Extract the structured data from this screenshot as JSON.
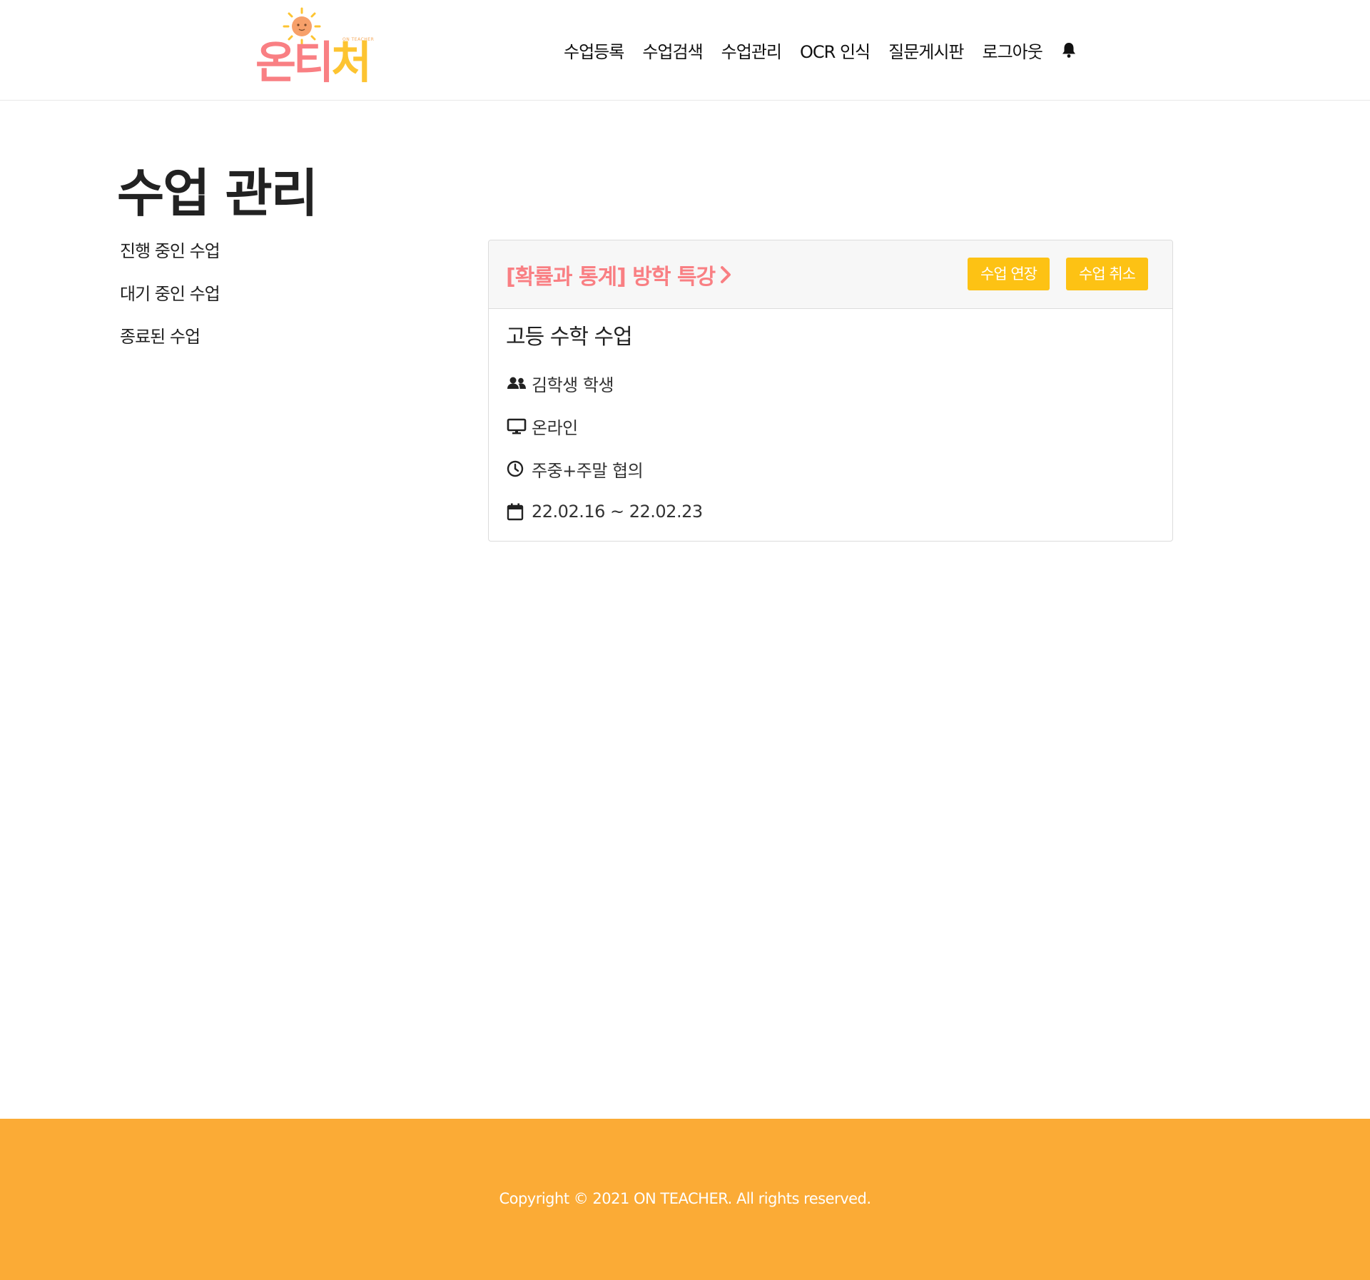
{
  "brand": {
    "logo_text_1": "온",
    "logo_text_2": "티",
    "logo_text_3": "처",
    "logo_sub": "ON TEACHER",
    "colors": {
      "pink": "#f97f83",
      "yellow": "#fdc431",
      "orange": "#fbab36",
      "button": "#fdc214"
    }
  },
  "nav": {
    "items": [
      {
        "label": "수업등록"
      },
      {
        "label": "수업검색"
      },
      {
        "label": "수업관리"
      },
      {
        "label": "OCR 인식"
      },
      {
        "label": "질문게시판"
      },
      {
        "label": "로그아웃"
      }
    ],
    "bell_icon": "bell-icon"
  },
  "page": {
    "title": "수업 관리"
  },
  "side_menu": {
    "items": [
      {
        "label": "진행 중인 수업"
      },
      {
        "label": "대기 중인 수업"
      },
      {
        "label": "종료된 수업"
      }
    ]
  },
  "card": {
    "title": "[확률과 통계] 방학 특강",
    "extend_label": "수업 연장",
    "cancel_label": "수업 취소",
    "course_name": "고등 수학 수업",
    "student": "김학생 학생",
    "mode": "온라인",
    "schedule": "주중+주말 협의",
    "period": "22.02.16 ~ 22.02.23"
  },
  "footer": {
    "copyright": "Copyright © 2021 ON TEACHER. All rights reserved."
  }
}
